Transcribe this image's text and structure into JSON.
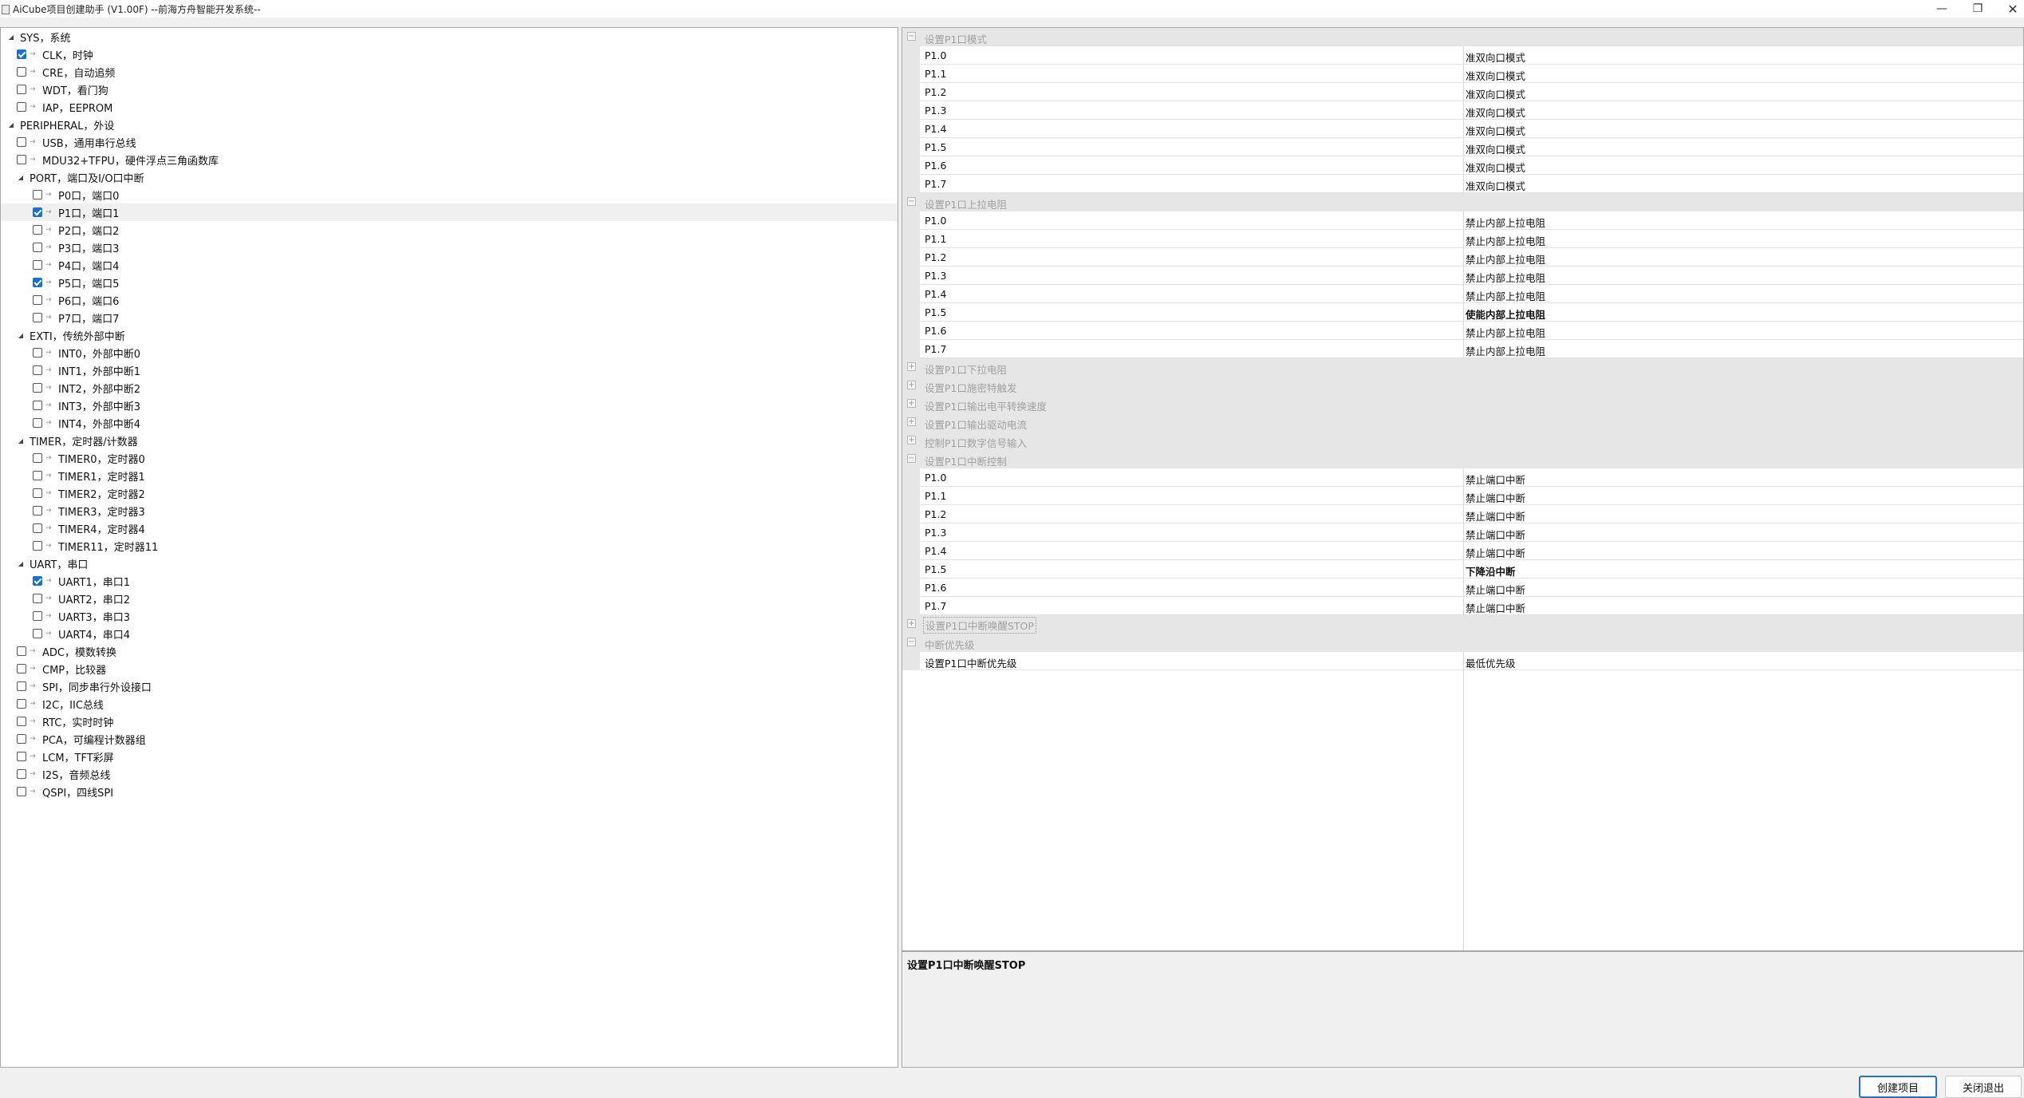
{
  "window": {
    "title": "AiCube项目创建助手 (V1.00F) --前海方舟智能开发系统--",
    "controls": {
      "minimize": "—",
      "maximize": "❐",
      "close": "✕"
    }
  },
  "tree": [
    {
      "label": "SYS，系统",
      "level": 0,
      "expandable": true
    },
    {
      "label": "CLK，时钟",
      "level": 1,
      "checked": true
    },
    {
      "label": "CRE，自动追频",
      "level": 1,
      "checked": false
    },
    {
      "label": "WDT，看门狗",
      "level": 1,
      "checked": false
    },
    {
      "label": "IAP，EEPROM",
      "level": 1,
      "checked": false
    },
    {
      "label": "PERIPHERAL，外设",
      "level": 0,
      "expandable": true
    },
    {
      "label": "USB，通用串行总线",
      "level": 1,
      "checked": false
    },
    {
      "label": "MDU32+TFPU，硬件浮点三角函数库",
      "level": 1,
      "checked": false
    },
    {
      "label": "PORT，端口及I/O口中断",
      "level": 1,
      "expandable": true
    },
    {
      "label": "P0口，端口0",
      "level": 2,
      "checked": false
    },
    {
      "label": "P1口，端口1",
      "level": 2,
      "checked": true,
      "selected": true
    },
    {
      "label": "P2口，端口2",
      "level": 2,
      "checked": false
    },
    {
      "label": "P3口，端口3",
      "level": 2,
      "checked": false
    },
    {
      "label": "P4口，端口4",
      "level": 2,
      "checked": false
    },
    {
      "label": "P5口，端口5",
      "level": 2,
      "checked": true
    },
    {
      "label": "P6口，端口6",
      "level": 2,
      "checked": false
    },
    {
      "label": "P7口，端口7",
      "level": 2,
      "checked": false
    },
    {
      "label": "EXTI，传统外部中断",
      "level": 1,
      "expandable": true
    },
    {
      "label": "INT0，外部中断0",
      "level": 2,
      "checked": false
    },
    {
      "label": "INT1，外部中断1",
      "level": 2,
      "checked": false
    },
    {
      "label": "INT2，外部中断2",
      "level": 2,
      "checked": false
    },
    {
      "label": "INT3，外部中断3",
      "level": 2,
      "checked": false
    },
    {
      "label": "INT4，外部中断4",
      "level": 2,
      "checked": false
    },
    {
      "label": "TIMER，定时器/计数器",
      "level": 1,
      "expandable": true
    },
    {
      "label": "TIMER0，定时器0",
      "level": 2,
      "checked": false
    },
    {
      "label": "TIMER1，定时器1",
      "level": 2,
      "checked": false
    },
    {
      "label": "TIMER2，定时器2",
      "level": 2,
      "checked": false
    },
    {
      "label": "TIMER3，定时器3",
      "level": 2,
      "checked": false
    },
    {
      "label": "TIMER4，定时器4",
      "level": 2,
      "checked": false
    },
    {
      "label": "TIMER11，定时器11",
      "level": 2,
      "checked": false
    },
    {
      "label": "UART，串口",
      "level": 1,
      "expandable": true
    },
    {
      "label": "UART1，串口1",
      "level": 2,
      "checked": true
    },
    {
      "label": "UART2，串口2",
      "level": 2,
      "checked": false
    },
    {
      "label": "UART3，串口3",
      "level": 2,
      "checked": false
    },
    {
      "label": "UART4，串口4",
      "level": 2,
      "checked": false
    },
    {
      "label": "ADC，模数转换",
      "level": 1,
      "checked": false
    },
    {
      "label": "CMP，比较器",
      "level": 1,
      "checked": false
    },
    {
      "label": "SPI，同步串行外设接口",
      "level": 1,
      "checked": false
    },
    {
      "label": "I2C，IIC总线",
      "level": 1,
      "checked": false
    },
    {
      "label": "RTC，实时时钟",
      "level": 1,
      "checked": false
    },
    {
      "label": "PCA，可编程计数器组",
      "level": 1,
      "checked": false
    },
    {
      "label": "LCM，TFT彩屏",
      "level": 1,
      "checked": false
    },
    {
      "label": "I2S，音频总线",
      "level": 1,
      "checked": false
    },
    {
      "label": "QSPI，四线SPI",
      "level": 1,
      "checked": false
    }
  ],
  "grid": [
    {
      "type": "cat",
      "label": "设置P1口模式",
      "expanded": true
    },
    {
      "type": "prop",
      "name": "P1.0",
      "value": "准双向口模式"
    },
    {
      "type": "prop",
      "name": "P1.1",
      "value": "准双向口模式"
    },
    {
      "type": "prop",
      "name": "P1.2",
      "value": "准双向口模式"
    },
    {
      "type": "prop",
      "name": "P1.3",
      "value": "准双向口模式"
    },
    {
      "type": "prop",
      "name": "P1.4",
      "value": "准双向口模式"
    },
    {
      "type": "prop",
      "name": "P1.5",
      "value": "准双向口模式"
    },
    {
      "type": "prop",
      "name": "P1.6",
      "value": "准双向口模式"
    },
    {
      "type": "prop",
      "name": "P1.7",
      "value": "准双向口模式"
    },
    {
      "type": "cat",
      "label": "设置P1口上拉电阻",
      "expanded": true
    },
    {
      "type": "prop",
      "name": "P1.0",
      "value": "禁止内部上拉电阻"
    },
    {
      "type": "prop",
      "name": "P1.1",
      "value": "禁止内部上拉电阻"
    },
    {
      "type": "prop",
      "name": "P1.2",
      "value": "禁止内部上拉电阻"
    },
    {
      "type": "prop",
      "name": "P1.3",
      "value": "禁止内部上拉电阻"
    },
    {
      "type": "prop",
      "name": "P1.4",
      "value": "禁止内部上拉电阻"
    },
    {
      "type": "prop",
      "name": "P1.5",
      "value": "使能内部上拉电阻",
      "bold": true
    },
    {
      "type": "prop",
      "name": "P1.6",
      "value": "禁止内部上拉电阻"
    },
    {
      "type": "prop",
      "name": "P1.7",
      "value": "禁止内部上拉电阻"
    },
    {
      "type": "cat",
      "label": "设置P1口下拉电阻",
      "expanded": false
    },
    {
      "type": "cat",
      "label": "设置P1口施密特触发",
      "expanded": false
    },
    {
      "type": "cat",
      "label": "设置P1口输出电平转换速度",
      "expanded": false
    },
    {
      "type": "cat",
      "label": "设置P1口输出驱动电流",
      "expanded": false
    },
    {
      "type": "cat",
      "label": "控制P1口数字信号输入",
      "expanded": false
    },
    {
      "type": "cat",
      "label": "设置P1口中断控制",
      "expanded": true
    },
    {
      "type": "prop",
      "name": "P1.0",
      "value": "禁止端口中断"
    },
    {
      "type": "prop",
      "name": "P1.1",
      "value": "禁止端口中断"
    },
    {
      "type": "prop",
      "name": "P1.2",
      "value": "禁止端口中断"
    },
    {
      "type": "prop",
      "name": "P1.3",
      "value": "禁止端口中断"
    },
    {
      "type": "prop",
      "name": "P1.4",
      "value": "禁止端口中断"
    },
    {
      "type": "prop",
      "name": "P1.5",
      "value": "下降沿中断",
      "bold": true
    },
    {
      "type": "prop",
      "name": "P1.6",
      "value": "禁止端口中断"
    },
    {
      "type": "prop",
      "name": "P1.7",
      "value": "禁止端口中断"
    },
    {
      "type": "cat",
      "label": "设置P1口中断唤醒STOP",
      "expanded": false,
      "focused": true
    },
    {
      "type": "cat",
      "label": "中断优先级",
      "expanded": true
    },
    {
      "type": "prop",
      "name": "设置P1口中断优先级",
      "value": "最低优先级"
    }
  ],
  "description": {
    "title": "设置P1口中断唤醒STOP"
  },
  "buttons": {
    "create": "创建项目",
    "exit": "关闭退出"
  },
  "colors": {
    "accent": "#1a6fd6",
    "category_bg": "#e6e6e6",
    "category_text": "#a0a0a0"
  }
}
